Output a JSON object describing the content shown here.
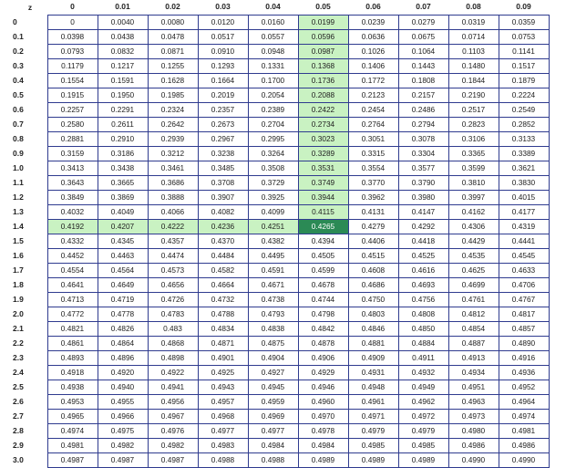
{
  "table": {
    "corner": "z",
    "columns": [
      "0",
      "0.01",
      "0.02",
      "0.03",
      "0.04",
      "0.05",
      "0.06",
      "0.07",
      "0.08",
      "0.09"
    ],
    "rows": [
      {
        "z": "0",
        "values": [
          "0",
          "0.0040",
          "0.0080",
          "0.0120",
          "0.0160",
          "0.0199",
          "0.0239",
          "0.0279",
          "0.0319",
          "0.0359"
        ]
      },
      {
        "z": "0.1",
        "values": [
          "0.0398",
          "0.0438",
          "0.0478",
          "0.0517",
          "0.0557",
          "0.0596",
          "0.0636",
          "0.0675",
          "0.0714",
          "0.0753"
        ]
      },
      {
        "z": "0.2",
        "values": [
          "0.0793",
          "0.0832",
          "0.0871",
          "0.0910",
          "0.0948",
          "0.0987",
          "0.1026",
          "0.1064",
          "0.1103",
          "0.1141"
        ]
      },
      {
        "z": "0.3",
        "values": [
          "0.1179",
          "0.1217",
          "0.1255",
          "0.1293",
          "0.1331",
          "0.1368",
          "0.1406",
          "0.1443",
          "0.1480",
          "0.1517"
        ]
      },
      {
        "z": "0.4",
        "values": [
          "0.1554",
          "0.1591",
          "0.1628",
          "0.1664",
          "0.1700",
          "0.1736",
          "0.1772",
          "0.1808",
          "0.1844",
          "0.1879"
        ]
      },
      {
        "z": "0.5",
        "values": [
          "0.1915",
          "0.1950",
          "0.1985",
          "0.2019",
          "0.2054",
          "0.2088",
          "0.2123",
          "0.2157",
          "0.2190",
          "0.2224"
        ]
      },
      {
        "z": "0.6",
        "values": [
          "0.2257",
          "0.2291",
          "0.2324",
          "0.2357",
          "0.2389",
          "0.2422",
          "0.2454",
          "0.2486",
          "0.2517",
          "0.2549"
        ]
      },
      {
        "z": "0.7",
        "values": [
          "0.2580",
          "0.2611",
          "0.2642",
          "0.2673",
          "0.2704",
          "0.2734",
          "0.2764",
          "0.2794",
          "0.2823",
          "0.2852"
        ]
      },
      {
        "z": "0.8",
        "values": [
          "0.2881",
          "0.2910",
          "0.2939",
          "0.2967",
          "0.2995",
          "0.3023",
          "0.3051",
          "0.3078",
          "0.3106",
          "0.3133"
        ]
      },
      {
        "z": "0.9",
        "values": [
          "0.3159",
          "0.3186",
          "0.3212",
          "0.3238",
          "0.3264",
          "0.3289",
          "0.3315",
          "0.3304",
          "0.3365",
          "0.3389"
        ]
      },
      {
        "z": "1.0",
        "values": [
          "0.3413",
          "0.3438",
          "0.3461",
          "0.3485",
          "0.3508",
          "0.3531",
          "0.3554",
          "0.3577",
          "0.3599",
          "0.3621"
        ]
      },
      {
        "z": "1.1",
        "values": [
          "0.3643",
          "0.3665",
          "0.3686",
          "0.3708",
          "0.3729",
          "0.3749",
          "0.3770",
          "0.3790",
          "0.3810",
          "0.3830"
        ]
      },
      {
        "z": "1.2",
        "values": [
          "0.3849",
          "0.3869",
          "0.3888",
          "0.3907",
          "0.3925",
          "0.3944",
          "0.3962",
          "0.3980",
          "0.3997",
          "0.4015"
        ]
      },
      {
        "z": "1.3",
        "values": [
          "0.4032",
          "0.4049",
          "0.4066",
          "0.4082",
          "0.4099",
          "0.4115",
          "0.4131",
          "0.4147",
          "0.4162",
          "0.4177"
        ]
      },
      {
        "z": "1.4",
        "values": [
          "0.4192",
          "0.4207",
          "0.4222",
          "0.4236",
          "0.4251",
          "0.4265",
          "0.4279",
          "0.4292",
          "0.4306",
          "0.4319"
        ]
      },
      {
        "z": "1.5",
        "values": [
          "0.4332",
          "0.4345",
          "0.4357",
          "0.4370",
          "0.4382",
          "0.4394",
          "0.4406",
          "0.4418",
          "0.4429",
          "0.4441"
        ]
      },
      {
        "z": "1.6",
        "values": [
          "0.4452",
          "0.4463",
          "0.4474",
          "0.4484",
          "0.4495",
          "0.4505",
          "0.4515",
          "0.4525",
          "0.4535",
          "0.4545"
        ]
      },
      {
        "z": "1.7",
        "values": [
          "0.4554",
          "0.4564",
          "0.4573",
          "0.4582",
          "0.4591",
          "0.4599",
          "0.4608",
          "0.4616",
          "0.4625",
          "0.4633"
        ]
      },
      {
        "z": "1.8",
        "values": [
          "0.4641",
          "0.4649",
          "0.4656",
          "0.4664",
          "0.4671",
          "0.4678",
          "0.4686",
          "0.4693",
          "0.4699",
          "0.4706"
        ]
      },
      {
        "z": "1.9",
        "values": [
          "0.4713",
          "0.4719",
          "0.4726",
          "0.4732",
          "0.4738",
          "0.4744",
          "0.4750",
          "0.4756",
          "0.4761",
          "0.4767"
        ]
      },
      {
        "z": "2.0",
        "values": [
          "0.4772",
          "0.4778",
          "0.4783",
          "0.4788",
          "0.4793",
          "0.4798",
          "0.4803",
          "0.4808",
          "0.4812",
          "0.4817"
        ]
      },
      {
        "z": "2.1",
        "values": [
          "0.4821",
          "0.4826",
          "0.483",
          "0.4834",
          "0.4838",
          "0.4842",
          "0.4846",
          "0.4850",
          "0.4854",
          "0.4857"
        ]
      },
      {
        "z": "2.2",
        "values": [
          "0.4861",
          "0.4864",
          "0.4868",
          "0.4871",
          "0.4875",
          "0.4878",
          "0.4881",
          "0.4884",
          "0.4887",
          "0.4890"
        ]
      },
      {
        "z": "2.3",
        "values": [
          "0.4893",
          "0.4896",
          "0.4898",
          "0.4901",
          "0.4904",
          "0.4906",
          "0.4909",
          "0.4911",
          "0.4913",
          "0.4916"
        ]
      },
      {
        "z": "2.4",
        "values": [
          "0.4918",
          "0.4920",
          "0.4922",
          "0.4925",
          "0.4927",
          "0.4929",
          "0.4931",
          "0.4932",
          "0.4934",
          "0.4936"
        ]
      },
      {
        "z": "2.5",
        "values": [
          "0.4938",
          "0.4940",
          "0.4941",
          "0.4943",
          "0.4945",
          "0.4946",
          "0.4948",
          "0.4949",
          "0.4951",
          "0.4952"
        ]
      },
      {
        "z": "2.6",
        "values": [
          "0.4953",
          "0.4955",
          "0.4956",
          "0.4957",
          "0.4959",
          "0.4960",
          "0.4961",
          "0.4962",
          "0.4963",
          "0.4964"
        ]
      },
      {
        "z": "2.7",
        "values": [
          "0.4965",
          "0.4966",
          "0.4967",
          "0.4968",
          "0.4969",
          "0.4970",
          "0.4971",
          "0.4972",
          "0.4973",
          "0.4974"
        ]
      },
      {
        "z": "2.8",
        "values": [
          "0.4974",
          "0.4975",
          "0.4976",
          "0.4977",
          "0.4977",
          "0.4978",
          "0.4979",
          "0.4979",
          "0.4980",
          "0.4981"
        ]
      },
      {
        "z": "2.9",
        "values": [
          "0.4981",
          "0.4982",
          "0.4982",
          "0.4983",
          "0.4984",
          "0.4984",
          "0.4985",
          "0.4985",
          "0.4986",
          "0.4986"
        ]
      },
      {
        "z": "3.0",
        "values": [
          "0.4987",
          "0.4987",
          "0.4987",
          "0.4988",
          "0.4988",
          "0.4989",
          "0.4989",
          "0.4989",
          "0.4990",
          "0.4990"
        ]
      }
    ],
    "highlight": {
      "row": 14,
      "col": 5
    },
    "colors": {
      "highlight_light": "#c9f2c2",
      "highlight_dark": "#2b8a55",
      "border": "#2f3b8f"
    }
  }
}
